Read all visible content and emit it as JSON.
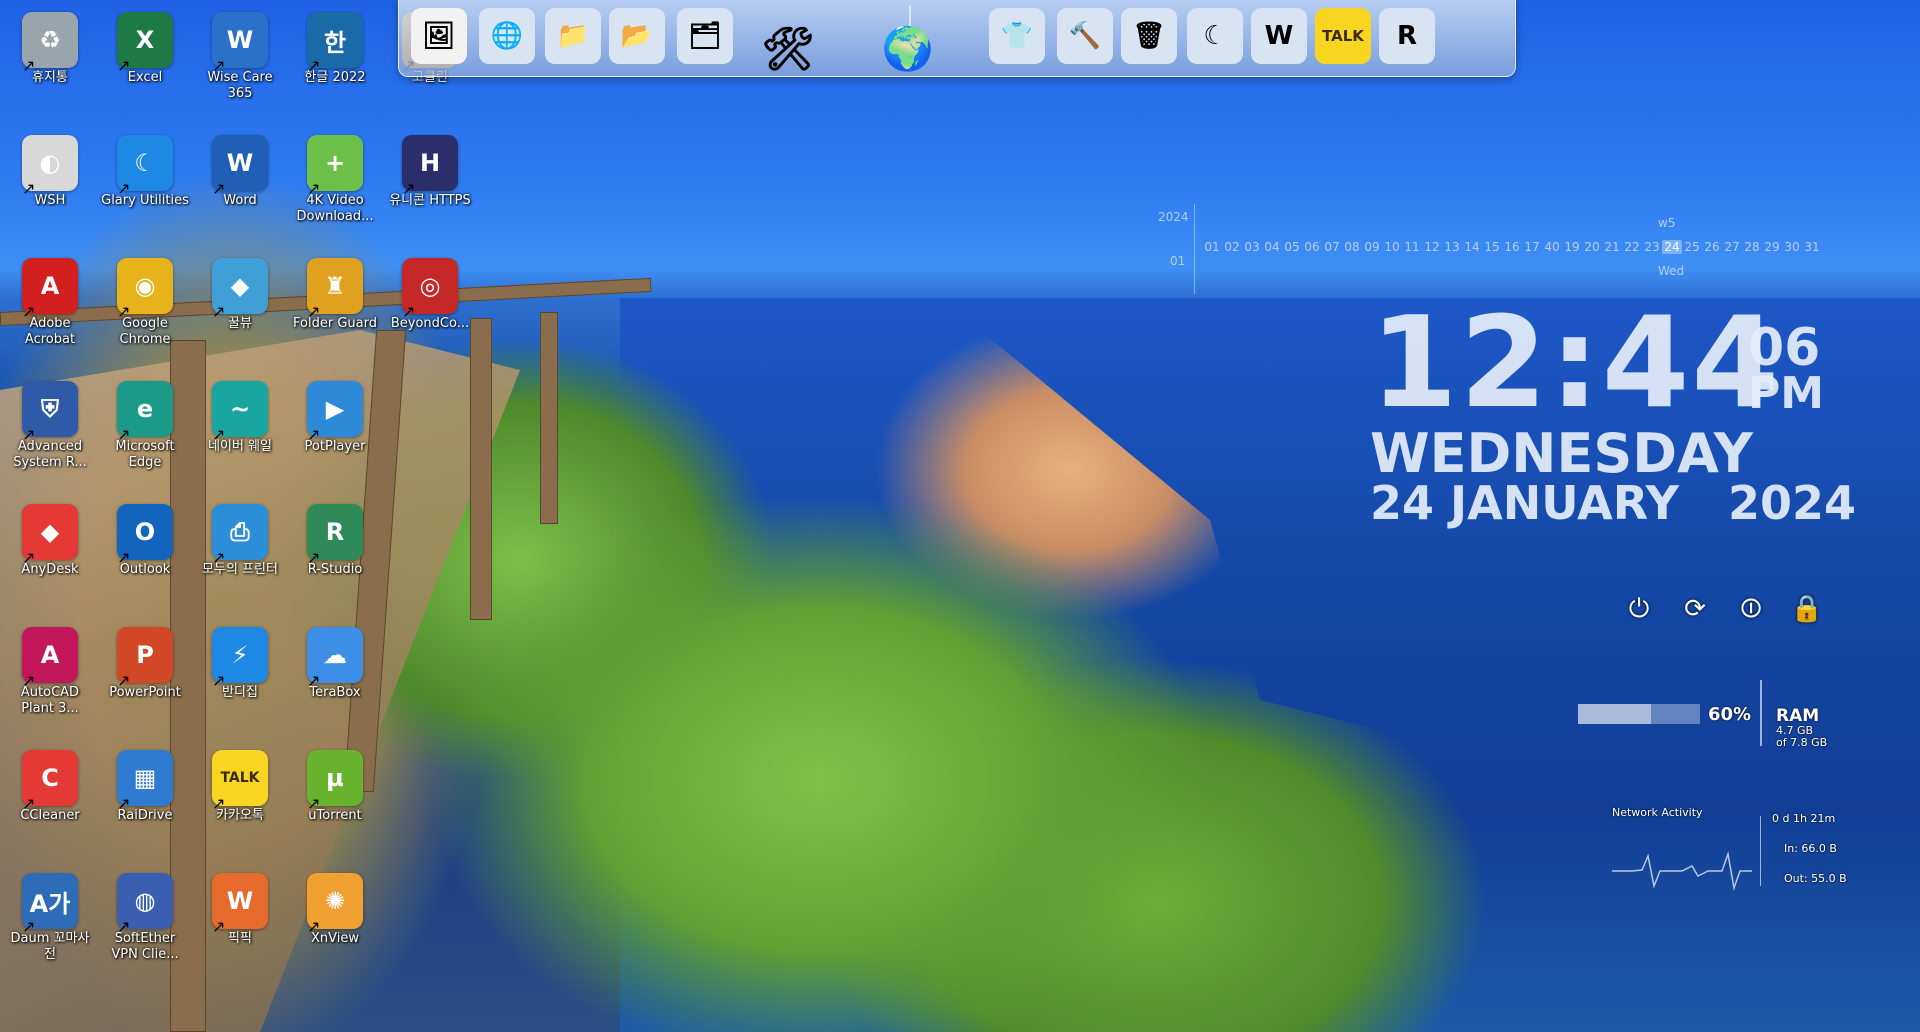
{
  "desktop_icons": [
    {
      "label": "휴지통",
      "glyph": "♻",
      "color": "#9aa4ad"
    },
    {
      "label": "Excel",
      "glyph": "X",
      "color": "#1d7a45"
    },
    {
      "label": "Wise Care 365",
      "glyph": "W",
      "color": "#2a72c9"
    },
    {
      "label": "한글 2022",
      "glyph": "한",
      "color": "#1a6aa8"
    },
    {
      "label": "고클린",
      "glyph": "G",
      "color": "#f1a23b"
    },
    {
      "label": "WSH",
      "glyph": "◐",
      "color": "#d8d8d8"
    },
    {
      "label": "Glary Utilities",
      "glyph": "☾",
      "color": "#1e88e5"
    },
    {
      "label": "Word",
      "glyph": "W",
      "color": "#1f5fb8"
    },
    {
      "label": "4K Video Download...",
      "glyph": "+",
      "color": "#6cc04a"
    },
    {
      "label": "유니콘 HTTPS",
      "glyph": "H",
      "color": "#2a2f6b"
    },
    {
      "label": "Adobe Acrobat",
      "glyph": "A",
      "color": "#d1201f"
    },
    {
      "label": "Google Chrome",
      "glyph": "◉",
      "color": "#e8b21a"
    },
    {
      "label": "꿀뷰",
      "glyph": "◆",
      "color": "#3f9fd6"
    },
    {
      "label": "Folder Guard",
      "glyph": "♜",
      "color": "#e0a020"
    },
    {
      "label": "BeyondCo...",
      "glyph": "◎",
      "color": "#c62828"
    },
    {
      "label": "Advanced System R...",
      "glyph": "⛨",
      "color": "#2f5aa8"
    },
    {
      "label": "Microsoft Edge",
      "glyph": "e",
      "color": "#1b9a8a"
    },
    {
      "label": "네이버 웨일",
      "glyph": "~",
      "color": "#1aa6a0"
    },
    {
      "label": "PotPlayer",
      "glyph": "▶",
      "color": "#2d8ad8"
    },
    {
      "label": "AnyDesk",
      "glyph": "◆",
      "color": "#e53935"
    },
    {
      "label": "Outlook",
      "glyph": "O",
      "color": "#1264bd"
    },
    {
      "label": "모두의 프린터",
      "glyph": "⎙",
      "color": "#2a8fd8"
    },
    {
      "label": "R-Studio",
      "glyph": "R",
      "color": "#2e8b57"
    },
    {
      "label": "AutoCAD Plant 3...",
      "glyph": "A",
      "color": "#c2185b"
    },
    {
      "label": "PowerPoint",
      "glyph": "P",
      "color": "#d24726"
    },
    {
      "label": "반디집",
      "glyph": "⚡",
      "color": "#1e88e5"
    },
    {
      "label": "TeraBox",
      "glyph": "☁",
      "color": "#3d8ee6"
    },
    {
      "label": "CCleaner",
      "glyph": "C",
      "color": "#e53935"
    },
    {
      "label": "RaiDrive",
      "glyph": "▦",
      "color": "#2f7bd1"
    },
    {
      "label": "카카오톡",
      "glyph": "TALK",
      "color": "#f7d520"
    },
    {
      "label": "uTorrent",
      "glyph": "µ",
      "color": "#67b32e"
    },
    {
      "label": "Daum 꼬마사전",
      "glyph": "A가",
      "color": "#2f6cb8"
    },
    {
      "label": "SoftEther VPN Clie...",
      "glyph": "◍",
      "color": "#3a5fb0"
    },
    {
      "label": "픽픽",
      "glyph": "W",
      "color": "#e66a2c"
    },
    {
      "label": "XnView",
      "glyph": "✺",
      "color": "#f0a030"
    }
  ],
  "dock": {
    "items": [
      {
        "name": "picture-viewer-icon",
        "glyph": "🖼",
        "bg": "#f2f2f2"
      },
      {
        "name": "network-globe-icon",
        "glyph": "🌐",
        "bg": "#d9e4f2"
      },
      {
        "name": "folder-icon",
        "glyph": "📁",
        "bg": "#d9e4f2"
      },
      {
        "name": "folder-green-icon",
        "glyph": "📂",
        "bg": "#d9e4f2"
      },
      {
        "name": "folder-open-icon",
        "glyph": "🗂",
        "bg": "#d9e4f2"
      },
      {
        "name": "tools-icon",
        "glyph": "🛠",
        "bg": "#d9e4f2"
      },
      {
        "name": "globe-icon",
        "glyph": "🌍",
        "bg": "#d9e4f2"
      },
      {
        "name": "tshirt-icon",
        "glyph": "👕",
        "bg": "#d9e4f2"
      },
      {
        "name": "hammer-icon",
        "glyph": "🔨",
        "bg": "#d9e4f2"
      },
      {
        "name": "recycle-bin-icon",
        "glyph": "🗑",
        "bg": "#d9e4f2"
      },
      {
        "name": "glary-utilities-icon",
        "glyph": "☾",
        "bg": "#d9e4f2"
      },
      {
        "name": "wise-care-icon",
        "glyph": "W",
        "bg": "#d9e4f2"
      },
      {
        "name": "kakaotalk-icon",
        "glyph": "TALK",
        "bg": "#f7d520"
      },
      {
        "name": "r-studio-icon",
        "glyph": "R",
        "bg": "#d9e4f2"
      }
    ]
  },
  "calendar": {
    "year": "2024",
    "month": "01",
    "week": "w5",
    "weekday": "Wed",
    "today": "24",
    "days": [
      "01",
      "02",
      "03",
      "04",
      "05",
      "06",
      "07",
      "08",
      "09",
      "10",
      "11",
      "12",
      "13",
      "14",
      "15",
      "16",
      "17",
      "40",
      "19",
      "20",
      "21",
      "22",
      "23",
      "24",
      "25",
      "26",
      "27",
      "28",
      "29",
      "30",
      "31"
    ]
  },
  "clock": {
    "time": "12:44",
    "seconds": "06",
    "ampm": "PM",
    "day": "WEDNESDAY",
    "date": "24 JANUARY",
    "year": "2024"
  },
  "power_buttons": [
    {
      "name": "shutdown-button",
      "glyph": "⏻"
    },
    {
      "name": "restart-button",
      "glyph": "⟳"
    },
    {
      "name": "logoff-button",
      "glyph": "⏼"
    },
    {
      "name": "lock-button",
      "glyph": "🔒"
    }
  ],
  "ram": {
    "percent_label": "60%",
    "percent": 60,
    "title": "RAM",
    "used": "4.7 GB",
    "total": "of 7.8 GB"
  },
  "network": {
    "title": "Network Activity",
    "uptime": "0 d 1h 21m",
    "in": "In: 66.0 B",
    "out": "Out: 55.0 B"
  }
}
